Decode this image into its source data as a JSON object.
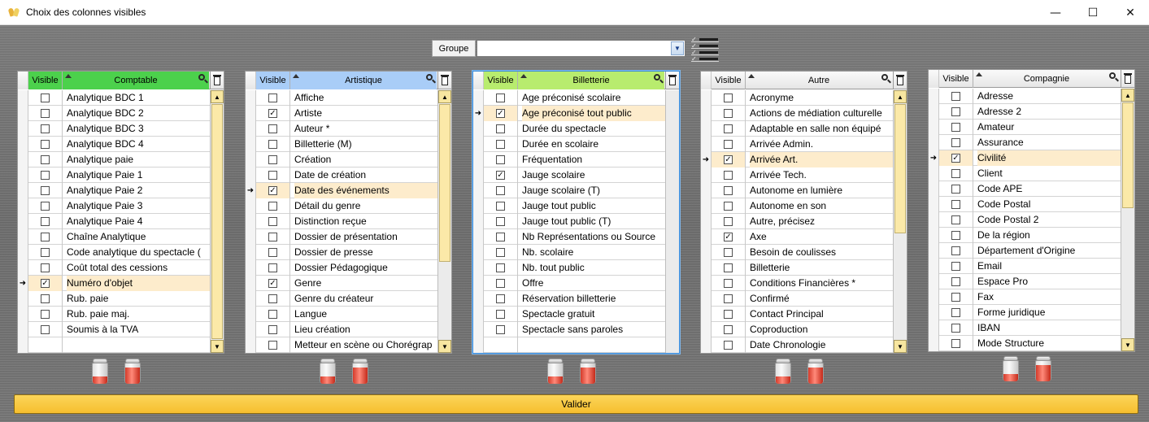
{
  "window": {
    "title": "Choix des colonnes visibles",
    "minimize": "—",
    "maximize": "☐",
    "close": "✕"
  },
  "groupe": {
    "label": "Groupe",
    "value": ""
  },
  "validate_label": "Valider",
  "colors": {
    "comptable_header": "#4cd14c",
    "artistique_header": "#a9cdf7",
    "billetterie_header": "#b8ec6e",
    "current_row": "#fdeccc",
    "validate_button": "#f6bf2e"
  },
  "panels": [
    {
      "id": "comptable",
      "visible_header": "Visible",
      "title": "Comptable",
      "scroll": {
        "thumb_fraction": 1.0
      },
      "rows": [
        {
          "label": "Analytique BDC 1",
          "checked": false,
          "current": false
        },
        {
          "label": "Analytique BDC 2",
          "checked": false,
          "current": false
        },
        {
          "label": "Analytique BDC 3",
          "checked": false,
          "current": false
        },
        {
          "label": "Analytique BDC 4",
          "checked": false,
          "current": false
        },
        {
          "label": "Analytique paie",
          "checked": false,
          "current": false
        },
        {
          "label": "Analytique Paie 1",
          "checked": false,
          "current": false
        },
        {
          "label": "Analytique Paie 2",
          "checked": false,
          "current": false
        },
        {
          "label": "Analytique Paie 3",
          "checked": false,
          "current": false
        },
        {
          "label": "Analytique Paie 4",
          "checked": false,
          "current": false
        },
        {
          "label": "Chaîne Analytique",
          "checked": false,
          "current": false
        },
        {
          "label": "Code analytique du spectacle (",
          "checked": false,
          "current": false
        },
        {
          "label": "Coût total des cessions",
          "checked": false,
          "current": false
        },
        {
          "label": "Numéro d'objet",
          "checked": true,
          "current": true
        },
        {
          "label": "Rub. paie",
          "checked": false,
          "current": false
        },
        {
          "label": "Rub. paie maj.",
          "checked": false,
          "current": false
        },
        {
          "label": "Soumis à la TVA",
          "checked": false,
          "current": false
        },
        {
          "label": "",
          "checked": null,
          "current": false
        }
      ]
    },
    {
      "id": "artistique",
      "visible_header": "Visible",
      "title": "Artistique",
      "scroll": {
        "thumb_fraction": 0.67
      },
      "rows": [
        {
          "label": "Affiche",
          "checked": false,
          "current": false
        },
        {
          "label": "Artiste",
          "checked": true,
          "current": false
        },
        {
          "label": "Auteur *",
          "checked": false,
          "current": false
        },
        {
          "label": "Billetterie (M)",
          "checked": false,
          "current": false
        },
        {
          "label": "Création",
          "checked": false,
          "current": false
        },
        {
          "label": "Date de création",
          "checked": false,
          "current": false
        },
        {
          "label": "Date des événements",
          "checked": true,
          "current": true
        },
        {
          "label": "Détail du genre",
          "checked": false,
          "current": false
        },
        {
          "label": "Distinction reçue",
          "checked": false,
          "current": false
        },
        {
          "label": "Dossier de présentation",
          "checked": false,
          "current": false
        },
        {
          "label": "Dossier de presse",
          "checked": false,
          "current": false
        },
        {
          "label": "Dossier Pédagogique",
          "checked": false,
          "current": false
        },
        {
          "label": "Genre",
          "checked": true,
          "current": false
        },
        {
          "label": "Genre du créateur",
          "checked": false,
          "current": false
        },
        {
          "label": "Langue",
          "checked": false,
          "current": false
        },
        {
          "label": "Lieu création",
          "checked": false,
          "current": false
        },
        {
          "label": "Metteur en scène ou Chorégrap",
          "checked": false,
          "current": false
        }
      ]
    },
    {
      "id": "billetterie",
      "visible_header": "Visible",
      "title": "Billetterie",
      "scroll": null,
      "rows": [
        {
          "label": "Age préconisé scolaire",
          "checked": false,
          "current": false
        },
        {
          "label": "Age préconisé tout public",
          "checked": true,
          "current": true
        },
        {
          "label": "Durée du spectacle",
          "checked": false,
          "current": false
        },
        {
          "label": "Durée en scolaire",
          "checked": false,
          "current": false
        },
        {
          "label": "Fréquentation",
          "checked": false,
          "current": false
        },
        {
          "label": "Jauge scolaire",
          "checked": true,
          "current": false
        },
        {
          "label": "Jauge scolaire (T)",
          "checked": false,
          "current": false
        },
        {
          "label": "Jauge tout public",
          "checked": false,
          "current": false
        },
        {
          "label": "Jauge tout public (T)",
          "checked": false,
          "current": false
        },
        {
          "label": "Nb Représentations ou Source",
          "checked": false,
          "current": false
        },
        {
          "label": "Nb. scolaire",
          "checked": false,
          "current": false
        },
        {
          "label": "Nb. tout public",
          "checked": false,
          "current": false
        },
        {
          "label": "Offre",
          "checked": false,
          "current": false
        },
        {
          "label": "Réservation billetterie",
          "checked": false,
          "current": false
        },
        {
          "label": "Spectacle gratuit",
          "checked": false,
          "current": false
        },
        {
          "label": "Spectacle sans paroles",
          "checked": false,
          "current": false
        },
        {
          "label": "",
          "checked": null,
          "current": false
        }
      ]
    },
    {
      "id": "autre",
      "visible_header": "Visible",
      "title": "Autre",
      "scroll": {
        "thumb_fraction": 0.55
      },
      "rows": [
        {
          "label": "Acronyme",
          "checked": false,
          "current": false
        },
        {
          "label": "Actions de médiation culturelle",
          "checked": false,
          "current": false
        },
        {
          "label": "Adaptable en salle non équipé",
          "checked": false,
          "current": false
        },
        {
          "label": "Arrivée Admin.",
          "checked": false,
          "current": false
        },
        {
          "label": "Arrivée Art.",
          "checked": true,
          "current": true
        },
        {
          "label": "Arrivée Tech.",
          "checked": false,
          "current": false
        },
        {
          "label": "Autonome en lumière",
          "checked": false,
          "current": false
        },
        {
          "label": "Autonome en son",
          "checked": false,
          "current": false
        },
        {
          "label": "Autre, précisez",
          "checked": false,
          "current": false
        },
        {
          "label": "Axe",
          "checked": true,
          "current": false
        },
        {
          "label": "Besoin de coulisses",
          "checked": false,
          "current": false
        },
        {
          "label": "Billetterie",
          "checked": false,
          "current": false
        },
        {
          "label": "Conditions Financières *",
          "checked": false,
          "current": false
        },
        {
          "label": "Confirmé",
          "checked": false,
          "current": false
        },
        {
          "label": "Contact Principal",
          "checked": false,
          "current": false
        },
        {
          "label": "Coproduction",
          "checked": false,
          "current": false
        },
        {
          "label": "Date Chronologie",
          "checked": false,
          "current": false
        }
      ]
    },
    {
      "id": "compagnie",
      "visible_header": "Visible",
      "title": "Compagnie",
      "scroll": {
        "thumb_fraction": 0.45
      },
      "rows": [
        {
          "label": "Adresse",
          "checked": false,
          "current": false
        },
        {
          "label": "Adresse 2",
          "checked": false,
          "current": false
        },
        {
          "label": "Amateur",
          "checked": false,
          "current": false
        },
        {
          "label": "Assurance",
          "checked": false,
          "current": false
        },
        {
          "label": "Civilité",
          "checked": true,
          "current": true
        },
        {
          "label": "Client",
          "checked": false,
          "current": false
        },
        {
          "label": "Code APE",
          "checked": false,
          "current": false
        },
        {
          "label": "Code Postal",
          "checked": false,
          "current": false
        },
        {
          "label": "Code Postal 2",
          "checked": false,
          "current": false
        },
        {
          "label": "De la région",
          "checked": false,
          "current": false
        },
        {
          "label": "Département d'Origine",
          "checked": false,
          "current": false
        },
        {
          "label": "Email",
          "checked": false,
          "current": false
        },
        {
          "label": "Espace Pro",
          "checked": false,
          "current": false
        },
        {
          "label": "Fax",
          "checked": false,
          "current": false
        },
        {
          "label": "Forme juridique",
          "checked": false,
          "current": false
        },
        {
          "label": "IBAN",
          "checked": false,
          "current": false
        },
        {
          "label": "Mode Structure",
          "checked": false,
          "current": false
        }
      ]
    }
  ]
}
